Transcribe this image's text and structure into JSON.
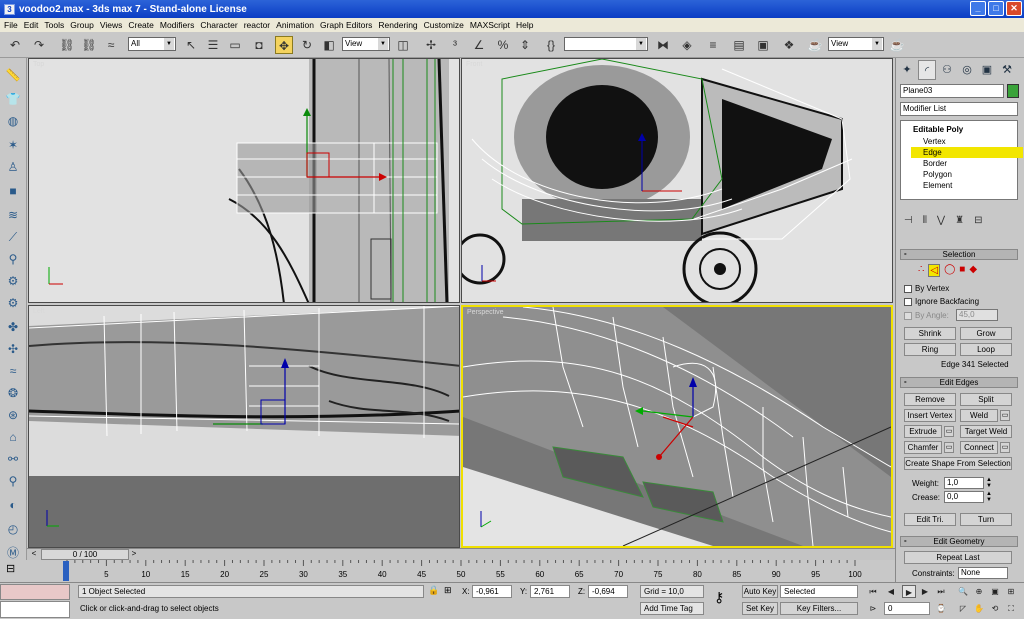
{
  "window": {
    "title": "voodoo2.max - 3ds max 7 - Stand-alone License",
    "app_icon": "3ds-max-icon",
    "min": "_",
    "max": "□",
    "close": "✕"
  },
  "menu": [
    "File",
    "Edit",
    "Tools",
    "Group",
    "Views",
    "Create",
    "Modifiers",
    "Character",
    "reactor",
    "Animation",
    "Graph Editors",
    "Rendering",
    "Customize",
    "MAXScript",
    "Help"
  ],
  "toolbar": {
    "selection_filter": "All",
    "ref_coord_1": "View",
    "named_selection": "",
    "ref_coord_2": "View"
  },
  "viewports": {
    "top_left_label": "Top",
    "top_right_label": "Front",
    "bottom_left_label": "Left",
    "bottom_right_label": "Perspective"
  },
  "timeline": {
    "frame_readout": "0 / 100",
    "prev": "<",
    "next": ">",
    "ticks": [
      "0",
      "5",
      "10",
      "15",
      "20",
      "25",
      "30",
      "35",
      "40",
      "45",
      "50",
      "55",
      "60",
      "65",
      "70",
      "75",
      "80",
      "85",
      "90",
      "95",
      "100"
    ]
  },
  "status": {
    "objects_selected": "1 Object Selected",
    "prompt": "Click or click-and-drag to select objects",
    "x_label": "X:",
    "x_value": "-0,961",
    "y_label": "Y:",
    "y_value": "2,761",
    "z_label": "Z:",
    "z_value": "-0,694",
    "grid": "Grid = 10,0",
    "add_time_tag": "Add Time Tag",
    "auto_key": "Auto Key",
    "set_key": "Set Key",
    "key_mode": "Selected",
    "key_filters": "Key Filters...",
    "current_frame": "0"
  },
  "panel": {
    "object_name": "Plane03",
    "object_color": "#3aa33a",
    "modifier_list": "Modifier List",
    "stack": {
      "root": "Editable Poly",
      "items": [
        "Vertex",
        "Edge",
        "Border",
        "Polygon",
        "Element"
      ],
      "selected_index": 1
    },
    "selection": {
      "title": "Selection",
      "by_vertex": "By Vertex",
      "ignore_backfacing": "Ignore Backfacing",
      "by_angle": "By Angle:",
      "angle_value": "45,0",
      "shrink": "Shrink",
      "grow": "Grow",
      "ring": "Ring",
      "loop": "Loop",
      "info": "Edge 341 Selected"
    },
    "edit_edges": {
      "title": "Edit Edges",
      "remove": "Remove",
      "split": "Split",
      "insert_vertex": "Insert Vertex",
      "weld": "Weld",
      "extrude": "Extrude",
      "target_weld": "Target Weld",
      "chamfer": "Chamfer",
      "connect": "Connect",
      "create_shape": "Create Shape From Selection",
      "weight_label": "Weight:",
      "weight_value": "1,0",
      "crease_label": "Crease:",
      "crease_value": "0,0",
      "edit_tri": "Edit Tri.",
      "turn": "Turn"
    },
    "edit_geometry": {
      "title": "Edit Geometry",
      "repeat_last": "Repeat Last",
      "constraints_label": "Constraints:",
      "constraints_value": "None"
    },
    "rollout_minus": "-"
  }
}
